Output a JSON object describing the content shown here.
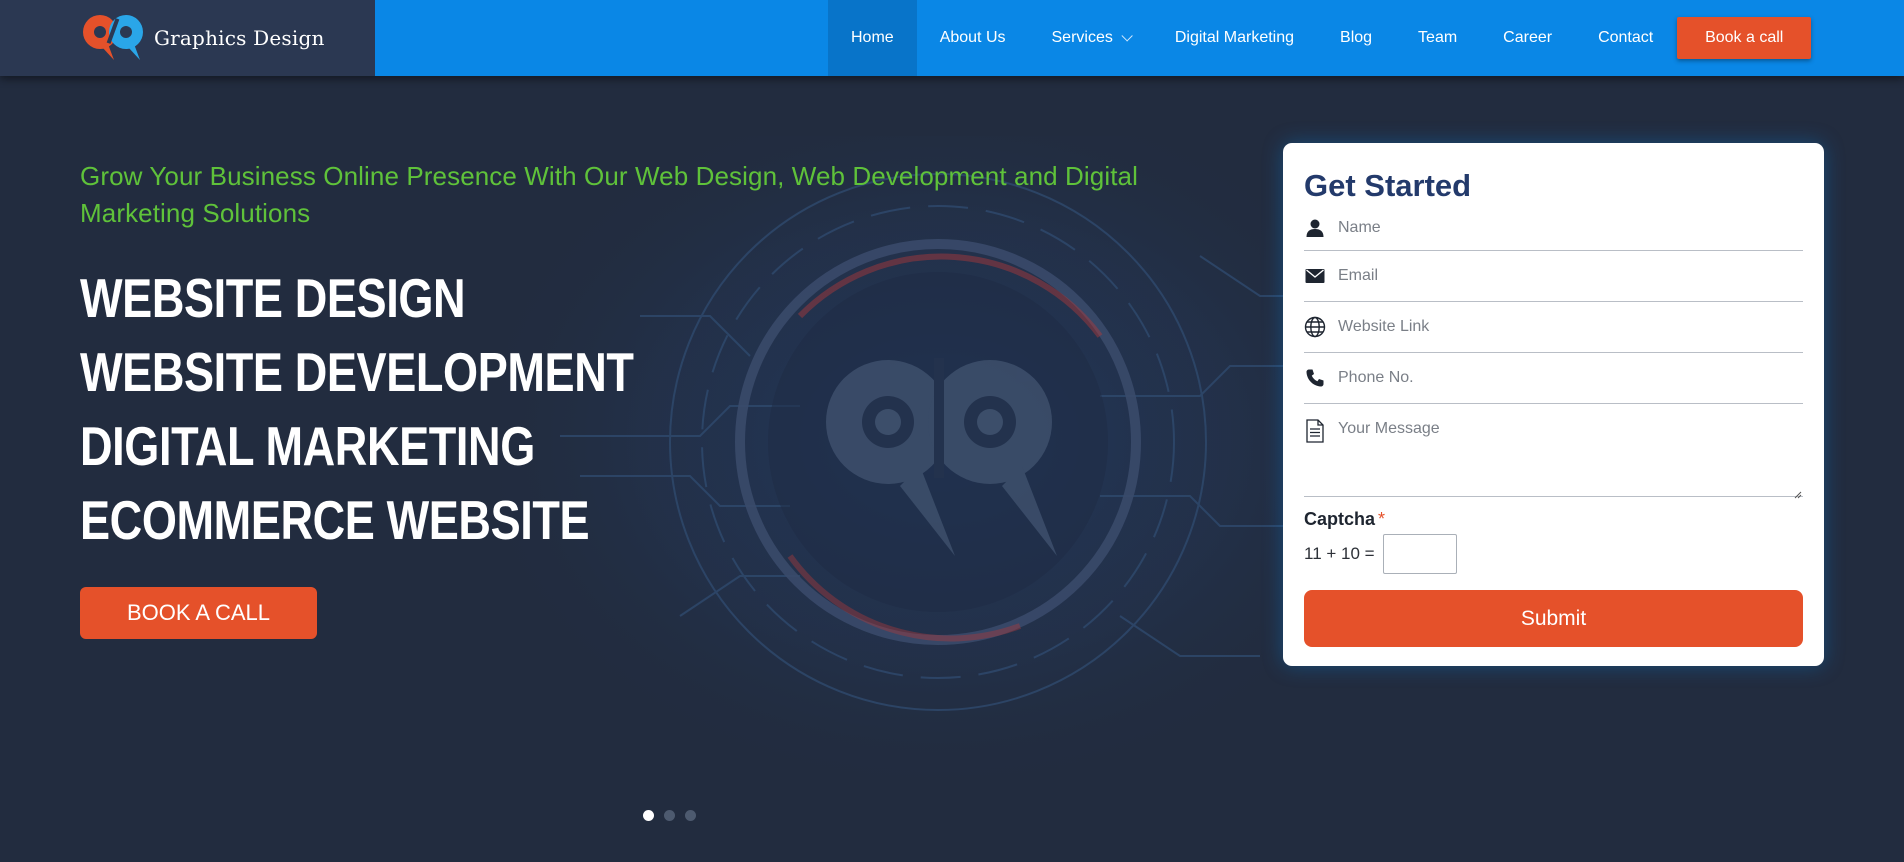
{
  "brand": {
    "name": "Graphics Design",
    "logo_colors": {
      "orange": "#e5512a",
      "blue": "#2aa6e8"
    }
  },
  "nav": {
    "items": [
      {
        "label": "Home",
        "active": true
      },
      {
        "label": "About Us"
      },
      {
        "label": "Services",
        "has_dropdown": true
      },
      {
        "label": "Digital Marketing"
      },
      {
        "label": "Blog"
      },
      {
        "label": "Team"
      },
      {
        "label": "Career"
      },
      {
        "label": "Contact"
      }
    ],
    "cta_label": "Book a call"
  },
  "hero": {
    "tagline": "Grow Your Business Online Presence With Our Web Design, Web Development and Digital Marketing Solutions",
    "lines": [
      "WEBSITE DESIGN",
      "WEBSITE DEVELOPMENT",
      "DIGITAL MARKETING",
      "ECOMMERCE WEBSITE"
    ],
    "button_label": "BOOK A CALL",
    "slide_count": 3,
    "active_slide": 1
  },
  "form": {
    "title": "Get Started",
    "fields": [
      {
        "icon": "user-icon",
        "placeholder": "Name"
      },
      {
        "icon": "envelope-icon",
        "placeholder": "Email"
      },
      {
        "icon": "globe-icon",
        "placeholder": "Website Link"
      },
      {
        "icon": "phone-icon",
        "placeholder": "Phone No."
      },
      {
        "icon": "document-icon",
        "placeholder": "Your Message"
      }
    ],
    "captcha_label": "Captcha",
    "captcha_required_mark": "*",
    "captcha_question": "11 + 10 =",
    "submit_label": "Submit"
  },
  "colors": {
    "nav_blue": "#0a87e6",
    "brand_bg": "#2b3852",
    "hero_bg": "#222c3f",
    "accent_orange": "#e5512a",
    "tagline_green": "#5fc23a",
    "form_title": "#233a6b"
  }
}
